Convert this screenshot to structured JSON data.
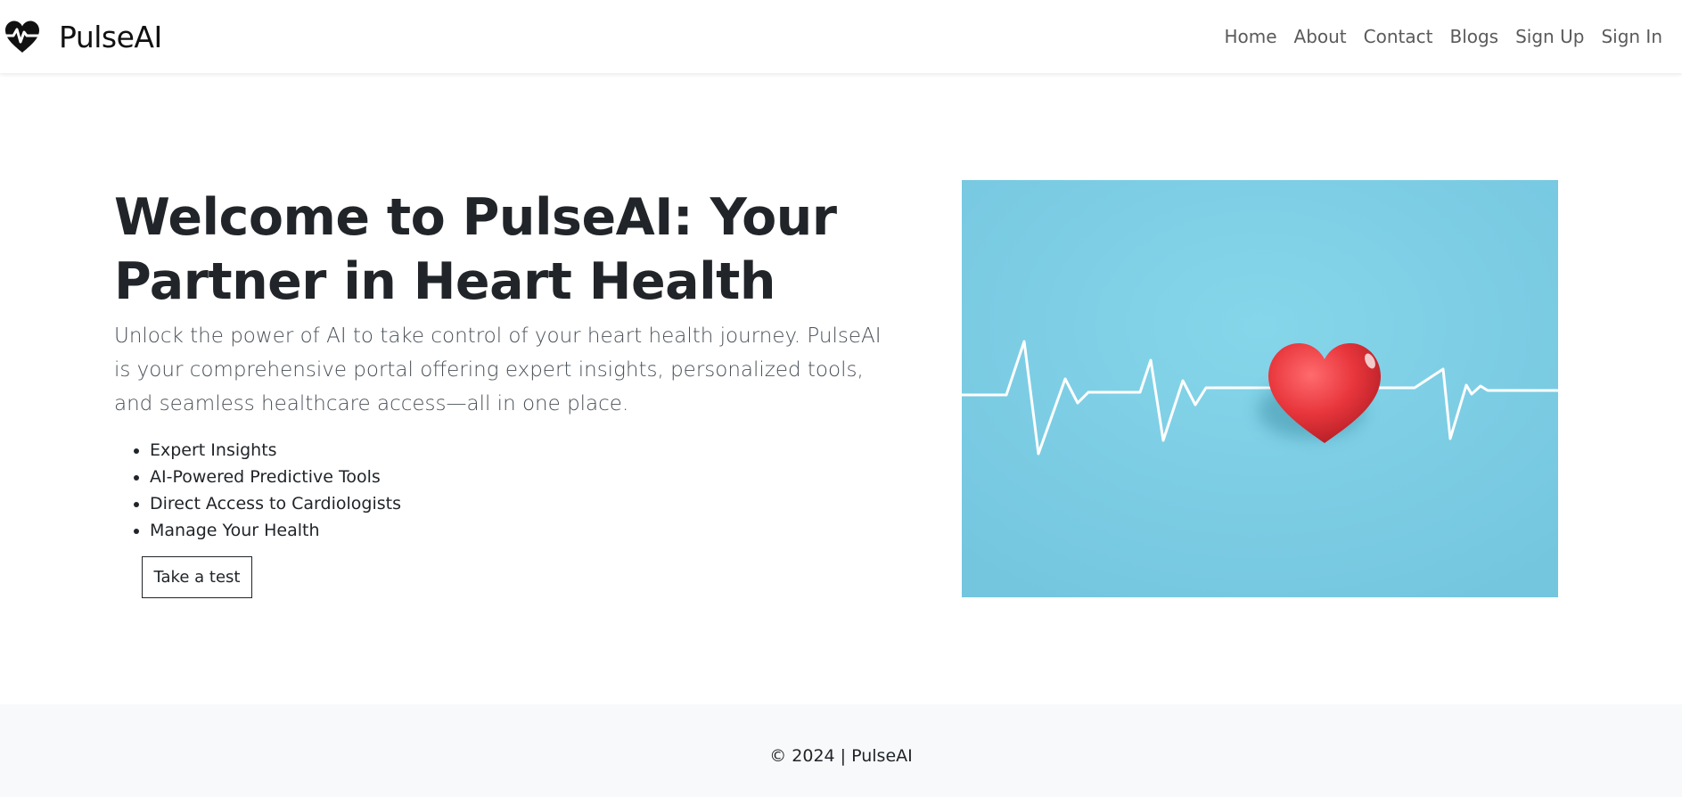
{
  "navbar": {
    "brand_name": "PulseAI",
    "brand_icon": "heart-pulse-icon",
    "links": [
      "Home",
      "About",
      "Contact",
      "Blogs",
      "Sign Up",
      "Sign In"
    ]
  },
  "hero": {
    "title": "Welcome to PulseAI: Your Partner in Heart Health",
    "description": "Unlock the power of AI to take control of your heart health journey. PulseAI is your comprehensive portal offering expert insights, personalized tools, and seamless healthcare access—all in one place.",
    "features": [
      "Expert Insights",
      "AI-Powered Predictive Tools",
      "Direct Access to Cardiologists",
      "Manage Your Health"
    ],
    "cta_label": "Take a test",
    "image": {
      "subject": "red-heart-with-ecg-line",
      "background_color": "#7ccfe3"
    }
  },
  "footer": {
    "text": "© 2024 | PulseAI"
  },
  "colors": {
    "text": "#212529",
    "muted": "#5a5a5a",
    "footer_bg": "#f8f9fa",
    "heart_red": "#e8363c"
  }
}
